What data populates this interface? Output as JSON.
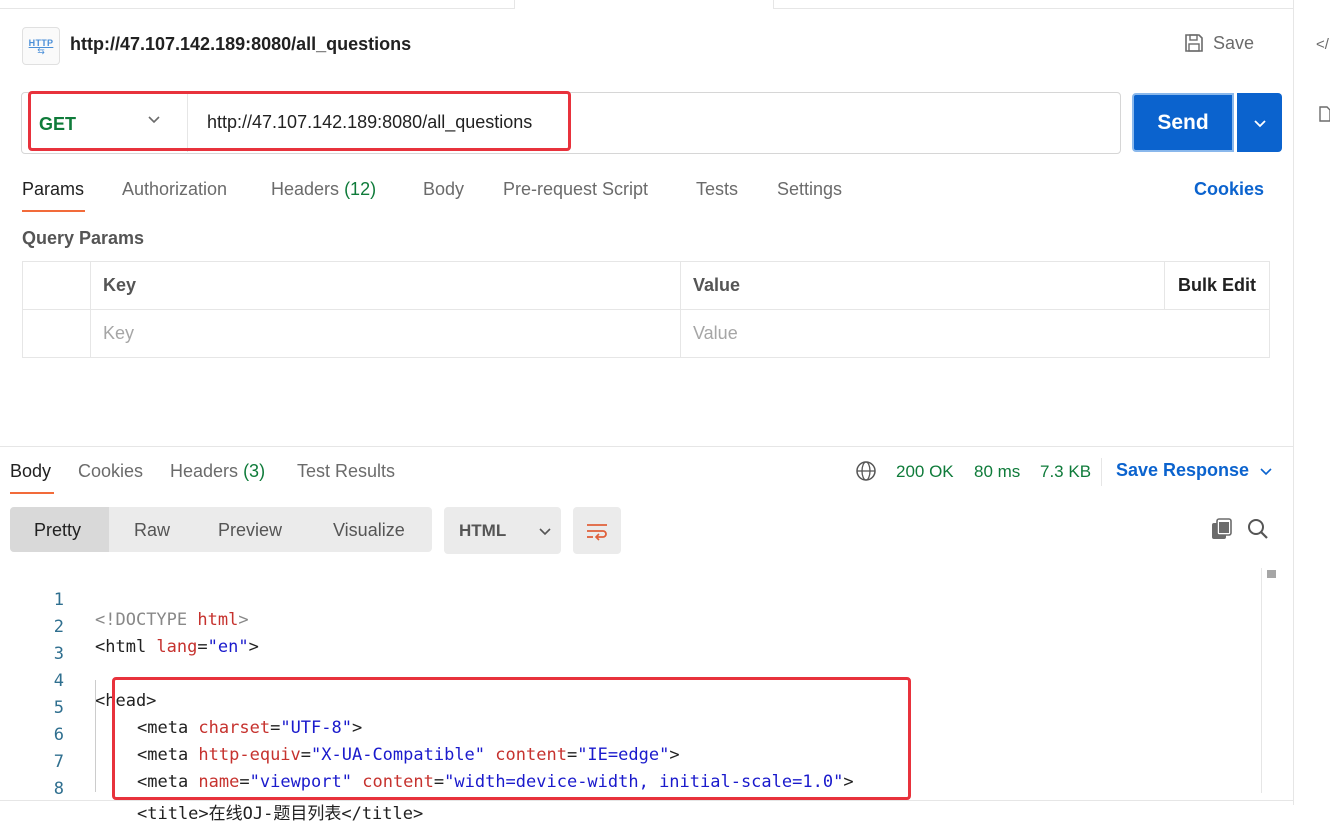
{
  "request": {
    "title": "http://47.107.142.189:8080/all_questions",
    "save_label": "Save",
    "method": "GET",
    "url": "http://47.107.142.189:8080/all_questions",
    "send_label": "Send",
    "icon_text": "HTTP"
  },
  "request_tabs": [
    {
      "label": "Params"
    },
    {
      "label": "Authorization"
    },
    {
      "label": "Headers",
      "count": "(12)"
    },
    {
      "label": "Body"
    },
    {
      "label": "Pre-request Script"
    },
    {
      "label": "Tests"
    },
    {
      "label": "Settings"
    }
  ],
  "cookies_link": "Cookies",
  "query_params": {
    "title": "Query Params",
    "col_key": "Key",
    "col_value": "Value",
    "bulk_edit": "Bulk Edit",
    "key_placeholder": "Key",
    "value_placeholder": "Value"
  },
  "response_tabs": [
    {
      "label": "Body"
    },
    {
      "label": "Cookies"
    },
    {
      "label": "Headers",
      "count": "(3)"
    },
    {
      "label": "Test Results"
    }
  ],
  "response_status": {
    "status": "200 OK",
    "time": "80 ms",
    "size": "7.3 KB",
    "save_response": "Save Response"
  },
  "view_modes": [
    "Pretty",
    "Raw",
    "Preview",
    "Visualize"
  ],
  "format_select": "HTML",
  "code_lines": [
    {
      "n": "1"
    },
    {
      "n": "2"
    },
    {
      "n": "3"
    },
    {
      "n": "4"
    },
    {
      "n": "5"
    },
    {
      "n": "6"
    },
    {
      "n": "7"
    },
    {
      "n": "8"
    }
  ],
  "code_text": {
    "l1_a": "<!",
    "l1_b": "DOCTYPE",
    "l1_c": "html",
    "l1_d": ">",
    "l2_a": "<html ",
    "l2_b": "lang",
    "l2_c": "=",
    "l2_d": "\"en\"",
    "l2_e": ">",
    "l4": "<head>",
    "l5_a": "<meta ",
    "l5_b": "charset",
    "l5_c": "=",
    "l5_d": "\"UTF-8\"",
    "l5_e": ">",
    "l6_a": "<meta ",
    "l6_b": "http-equiv",
    "l6_c": "=",
    "l6_d": "\"X-UA-Compatible\"",
    "l6_e": " ",
    "l6_f": "content",
    "l6_g": "=",
    "l6_h": "\"IE=edge\"",
    "l6_i": ">",
    "l7_a": "<meta ",
    "l7_b": "name",
    "l7_c": "=",
    "l7_d": "\"viewport\"",
    "l7_e": " ",
    "l7_f": "content",
    "l7_g": "=",
    "l7_h": "\"width=device-width, initial-scale=1.0\"",
    "l7_i": ">",
    "l8": "<title>在线OJ-题目列表</title>"
  }
}
